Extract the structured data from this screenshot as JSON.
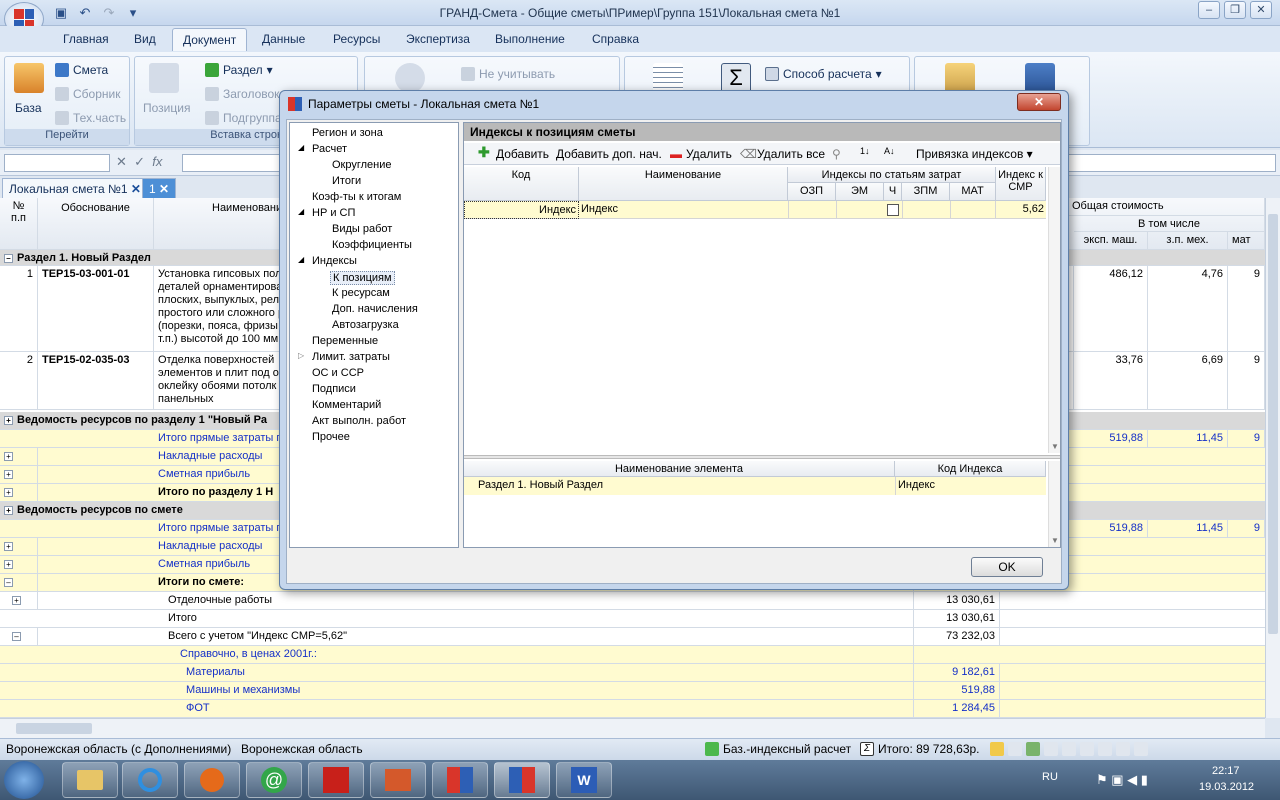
{
  "window": {
    "title": "ГРАНД-Смета - Общие сметы\\ПРимер\\Группа 151\\Локальная смета №1"
  },
  "tabs": [
    "Главная",
    "Вид",
    "Документ",
    "Данные",
    "Ресурсы",
    "Экспертиза",
    "Выполнение",
    "Справка"
  ],
  "ribbon": {
    "baza": "База",
    "smeta": "Смета",
    "sbornik": "Сборник",
    "tekh": "Тех.часть",
    "pereiti": "Перейти",
    "pozitsiya": "Позиция",
    "razdel": "Раздел",
    "zagolovok": "Заголовок",
    "podgruppa": "Подгруппа",
    "vstavka": "Вставка строк",
    "ne_uchityvat": "Не учитывать",
    "sposob": "Способ расчета"
  },
  "doctabs": [
    "Локальная смета №1",
    "1"
  ],
  "grid": {
    "headers": {
      "num": "№ п.п",
      "obosn": "Обоснование",
      "naim": "Наименование",
      "obsh": "Общая стоимость",
      "vtom": "В том числе",
      "ekspmash": "эксп. маш.",
      "zpmeh": "з.п. мех.",
      "mat": "мат"
    },
    "section1": "Раздел 1. Новый Раздел",
    "items": [
      {
        "n": "1",
        "code": "ТЕР15-03-001-01",
        "text": [
          "Установка гипсовых пол",
          "деталей орнаментирова",
          "плоских, выпуклых, рел",
          "простого или сложного р",
          "(порезки, пояса, фризы",
          "т.п.) высотой до 100 мм"
        ],
        "ekspmash": "486,12",
        "zpmeh": "4,76",
        "mat": "9"
      },
      {
        "n": "2",
        "code": "ТЕР15-02-035-03",
        "text": [
          "Отделка поверхностей",
          "элементов и плит под ок",
          "оклейку обоями потолк",
          "панельных"
        ],
        "ekspmash": "33,76",
        "zpmeh": "6,69",
        "mat": "9"
      }
    ],
    "vedomost1": "Ведомость ресурсов по разделу 1 \"Новый Ра",
    "itogo_pryamye": "Итого прямые затраты п",
    "nakladnye": "Накладные расходы",
    "smetnaya": "Сметная прибыль",
    "itogo_razdel": "Итого по разделу 1 Н",
    "vedomost2": "Ведомость ресурсов по смете",
    "itogi_smeta": "Итоги по смете:",
    "otdelochnye": "Отделочные работы",
    "itogo": "Итого",
    "vsego": "Всего с учетом \"Индекс СМР=5,62\"",
    "spravochno": "Справочно, в ценах 2001г.:",
    "materialy": "Материалы",
    "mashiny": "Машины и механизмы",
    "fot": "ФОТ",
    "v_519": "519,88",
    "v_1145": "11,45",
    "v_9": "9",
    "v_otd": "13 030,61",
    "v_itogo": "13 030,61",
    "v_vsego": "73 232,03",
    "v_mat": "9 182,61",
    "v_mash": "519,88",
    "v_fot": "1 284,45"
  },
  "status": {
    "region": "Воронежская область (с Дополнениями)",
    "region2": "Воронежская область",
    "calc": "Баз.-индексный расчет",
    "itogo": "Итого: 89 728,63р."
  },
  "taskbar": {
    "lang": "RU",
    "time": "22:17",
    "date": "19.03.2012"
  },
  "dialog": {
    "title": "Параметры сметы - Локальная смета №1",
    "tree": [
      "Регион и зона",
      "Расчет",
      "Округление",
      "Итоги",
      "Коэф-ты к итогам",
      "НР и СП",
      "Виды работ",
      "Коэффициенты",
      "Индексы",
      "К позициям",
      "К ресурсам",
      "Доп. начисления",
      "Автозагрузка",
      "Переменные",
      "Лимит. затраты",
      "ОС и ССР",
      "Подписи",
      "Комментарий",
      "Акт выполн. работ",
      "Прочее"
    ],
    "panel_title": "Индексы к позициям сметы",
    "tools": {
      "add": "Добавить",
      "add_extra": "Добавить доп. нач.",
      "delete": "Удалить",
      "delete_all": "Удалить все",
      "bind": "Привязка индексов"
    },
    "cols": {
      "kod": "Код",
      "naim": "Наименование",
      "by_items": "Индексы по статьям затрат",
      "ozp": "ОЗП",
      "em": "ЭМ",
      "ch": "Ч",
      "zpm": "ЗПМ",
      "mat": "МАТ",
      "smr": "Индекс к СМР"
    },
    "row": {
      "kod": "Индекс",
      "naim": "Индекс",
      "smr": "5,62"
    },
    "lower_cols": {
      "elem": "Наименование элемента",
      "kod": "Код Индекса"
    },
    "lower_row": {
      "elem": "Раздел 1. Новый Раздел",
      "kod": "Индекс"
    },
    "ok": "OK"
  },
  "colors": {
    "accent": "#1530c8",
    "selection": "#fffbd0",
    "section": "#d9d9d9"
  }
}
